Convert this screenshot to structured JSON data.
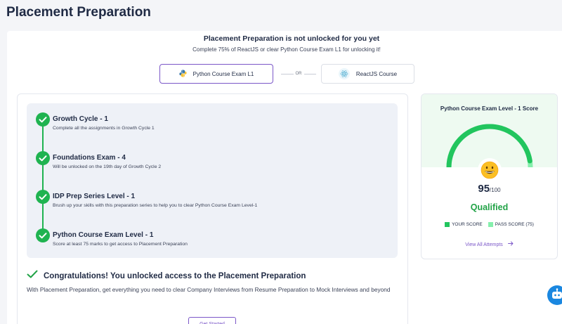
{
  "page": {
    "title": "Placement Preparation"
  },
  "lock": {
    "title": "Placement Preparation is not unlocked for you yet",
    "subtitle": "Complete 75% of ReactJS or clear Python Course Exam L1 for unlocking it!"
  },
  "options": {
    "python_label": "Python Course Exam L1",
    "or_label": "OR",
    "react_label": "ReactJS Course"
  },
  "steps": [
    {
      "title": "Growth Cycle - 1",
      "desc": "Complete all the assignments in Growth Cycle 1"
    },
    {
      "title": "Foundations Exam - 4",
      "desc": "Will be unlocked on the 19th day of Growth Cycle 2"
    },
    {
      "title": "IDP Prep Series Level - 1",
      "desc": "Brush up your skills with this preparation series to help you to clear Python Course Exam Level-1"
    },
    {
      "title": "Python Course Exam Level - 1",
      "desc": "Score at least 75 marks to get access to Placement Preparation"
    }
  ],
  "congrats": {
    "title": "Congratulations! You unlocked access to the Placement Preparation",
    "desc": "With Placement Preparation, get everything you need to clear Company Interviews from Resume Preparation to Mock Interviews and beyond",
    "button_label": "Get Started"
  },
  "score": {
    "title": "Python Course Exam Level - 1 Score",
    "value": "95",
    "max": "/100",
    "score_fraction": 0.95,
    "status": "Qualified",
    "legend_your": "YOUR SCORE",
    "legend_pass": "PASS SCORE (75)",
    "view_attempts": "View All Attempts",
    "colors": {
      "your": "#22c55e",
      "pass": "#86efac",
      "accent": "#7b57c8"
    }
  },
  "icons": {
    "python": "python-logo-icon",
    "react": "react-logo-icon",
    "check": "check-icon",
    "emoji": "grinning-face-icon",
    "arrow": "arrow-right-icon",
    "bot": "chatbot-icon"
  }
}
